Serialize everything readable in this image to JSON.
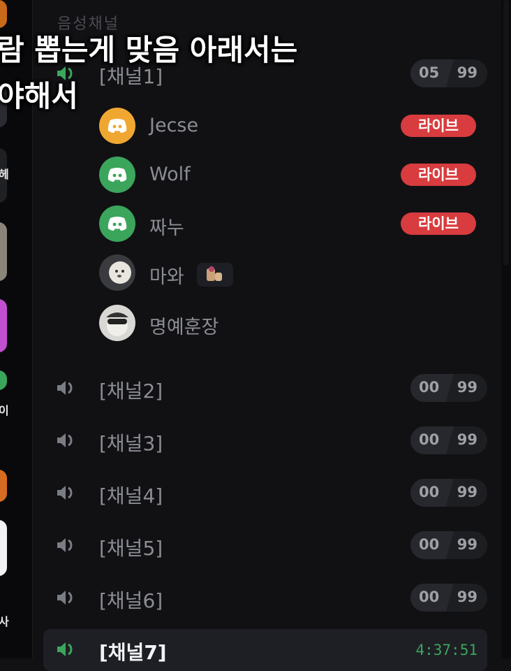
{
  "category": {
    "label": "음성채널"
  },
  "caption": {
    "line1": "람 뽑는게 맞음 아래서는",
    "line2": "야해서"
  },
  "server_list": {
    "partial_labels": [
      "헤",
      "이",
      "사"
    ]
  },
  "channels": [
    {
      "name": "[채널1]",
      "current": "05",
      "max": "99"
    },
    {
      "name": "[채널2]",
      "current": "00",
      "max": "99"
    },
    {
      "name": "[채널3]",
      "current": "00",
      "max": "99"
    },
    {
      "name": "[채널4]",
      "current": "00",
      "max": "99"
    },
    {
      "name": "[채널5]",
      "current": "00",
      "max": "99"
    },
    {
      "name": "[채널6]",
      "current": "00",
      "max": "99"
    },
    {
      "name": "[채널7]",
      "elapsed": "4:37:51"
    }
  ],
  "members": [
    {
      "name": "Jecse",
      "badge": "라이브",
      "avatar": "discord-logo-icon",
      "avatar_color": "#f0a732"
    },
    {
      "name": "Wolf",
      "badge": "라이브",
      "avatar": "discord-logo-icon",
      "avatar_color": "#3ba55c"
    },
    {
      "name": "짜누",
      "badge": "라이브",
      "avatar": "discord-logo-icon",
      "avatar_color": "#3ba55c"
    },
    {
      "name": "마와",
      "avatar": "photo-avatar",
      "status_icon": "emoji-status-icon"
    },
    {
      "name": "명예훈장",
      "avatar": "photo-avatar"
    }
  ],
  "colors": {
    "live": "#d83c3e",
    "voice_active": "#3ba55c",
    "background": "#111114"
  }
}
